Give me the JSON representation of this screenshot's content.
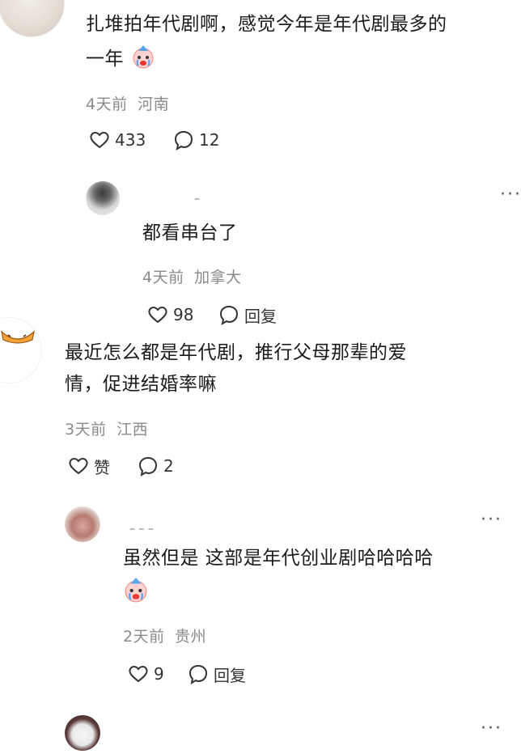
{
  "comments": [
    {
      "text_line1": "扎堆拍年代剧啊，感觉今年是年代剧最多的",
      "text_line2": "一年",
      "meta_time": "4天前",
      "meta_location": "河南",
      "likes": "433",
      "replies": "12",
      "emoji_icon": "crying-clown-emoji"
    },
    {
      "text": "都看串台了",
      "meta_time": "4天前",
      "meta_location": "加拿大",
      "likes": "98",
      "reply_label": "回复",
      "more": "···"
    },
    {
      "text_line1": "最近怎么都是年代剧，推行父母那辈的爱",
      "text_line2": "情，促进结婚率嘛",
      "meta_time": "3天前",
      "meta_location": "江西",
      "likes": "赞",
      "replies": "2"
    },
    {
      "text": "虽然但是 这部是年代创业剧哈哈哈哈",
      "meta_time": "2天前",
      "meta_location": "贵州",
      "likes": "9",
      "reply_label": "回复",
      "more": "···",
      "emoji_icon": "crying-clown-emoji"
    },
    {
      "more": "···"
    }
  ],
  "colors": {
    "text": "#1b1b1b",
    "meta": "#8a8a8a",
    "icon": "#333333"
  }
}
